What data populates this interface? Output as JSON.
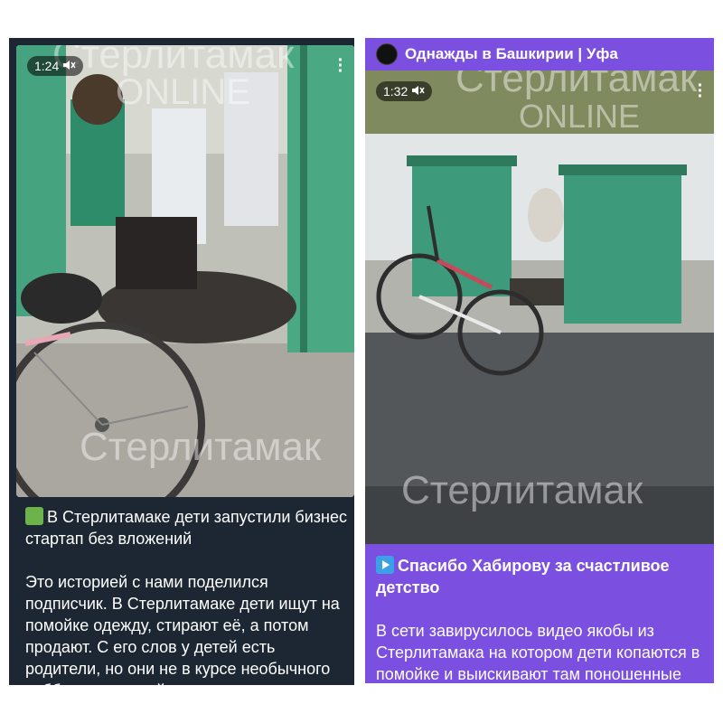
{
  "left_post": {
    "video": {
      "time": "1:24",
      "watermark_top": "Стерлитамак",
      "watermark_mid": "ONLINE",
      "watermark_bottom": "Стерлитамак"
    },
    "headline": "В Стерлитамаке дети запустили бизнес стартап без вложений",
    "body": "Это историей с нами поделился подписчик. В Стерлитамаке дети ищут на помойке одежду, стирают её, а потом продают. С его слов у детей есть родители, но они не в курсе необычного хобби своих детей."
  },
  "right_post": {
    "channel": "Однажды в Башкирии | Уфа",
    "video": {
      "time": "1:32",
      "watermark_top": "Стерлитамак",
      "watermark_mid": "ONLINE",
      "watermark_bottom": "Стерлитамак"
    },
    "headline": "Спасибо Хабирову за счастливое детство",
    "body": "В сети завирусилось видео якобы из Стерлитамака на котором дети копаются в помойке и выискивают там поношенные вещи."
  },
  "colors": {
    "left_bg": "#1d2733",
    "right_bg": "#7b4fe0",
    "bin_green": "#3d9a7a"
  },
  "icons": [
    "mute-icon",
    "kebab-menu-icon",
    "play-button-emoji",
    "frog-emoji"
  ]
}
